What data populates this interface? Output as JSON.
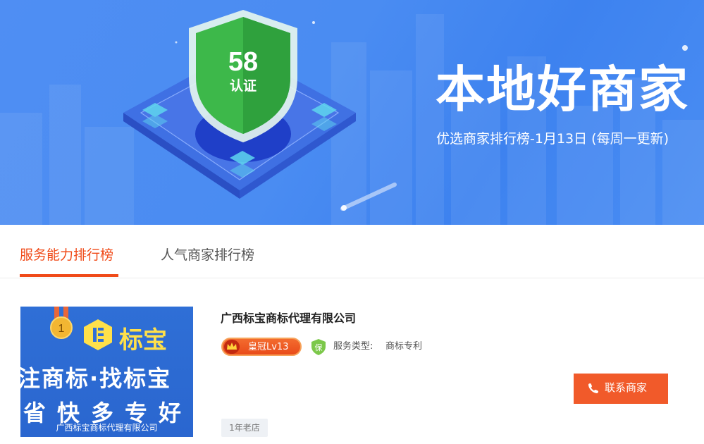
{
  "banner": {
    "badge_number": "58",
    "badge_text": "认证",
    "title": "本地好商家",
    "subtitle": "优选商家排行榜-1月13日 (每周一更新)"
  },
  "tabs": [
    {
      "label": "服务能力排行榜",
      "active": true
    },
    {
      "label": "人气商家排行榜",
      "active": false
    }
  ],
  "merchant": {
    "rank": "1",
    "thumb_brand": "标宝",
    "thumb_slogan_1": "注商标·找标宝",
    "thumb_slogan_2": "省快多专好",
    "thumb_footer": "广西标宝商标代理有限公司",
    "name": "广西标宝商标代理有限公司",
    "level": "皇冠Lv13",
    "guarantee_icon_text": "保",
    "service_type_label": "服务类型:",
    "service_type_value": "商标专利",
    "contact_label": "联系商家",
    "age_tag": "1年老店"
  },
  "colors": {
    "accent": "#f04a18",
    "banner_blue": "#4a8cf2",
    "contact_button": "#f15a2a",
    "badge_green": "#3db84a"
  },
  "icons": {
    "shield": "shield-58-icon",
    "crown": "crown-icon",
    "guarantee": "bao-shield-icon",
    "phone": "phone-icon",
    "medal": "medal-icon"
  }
}
